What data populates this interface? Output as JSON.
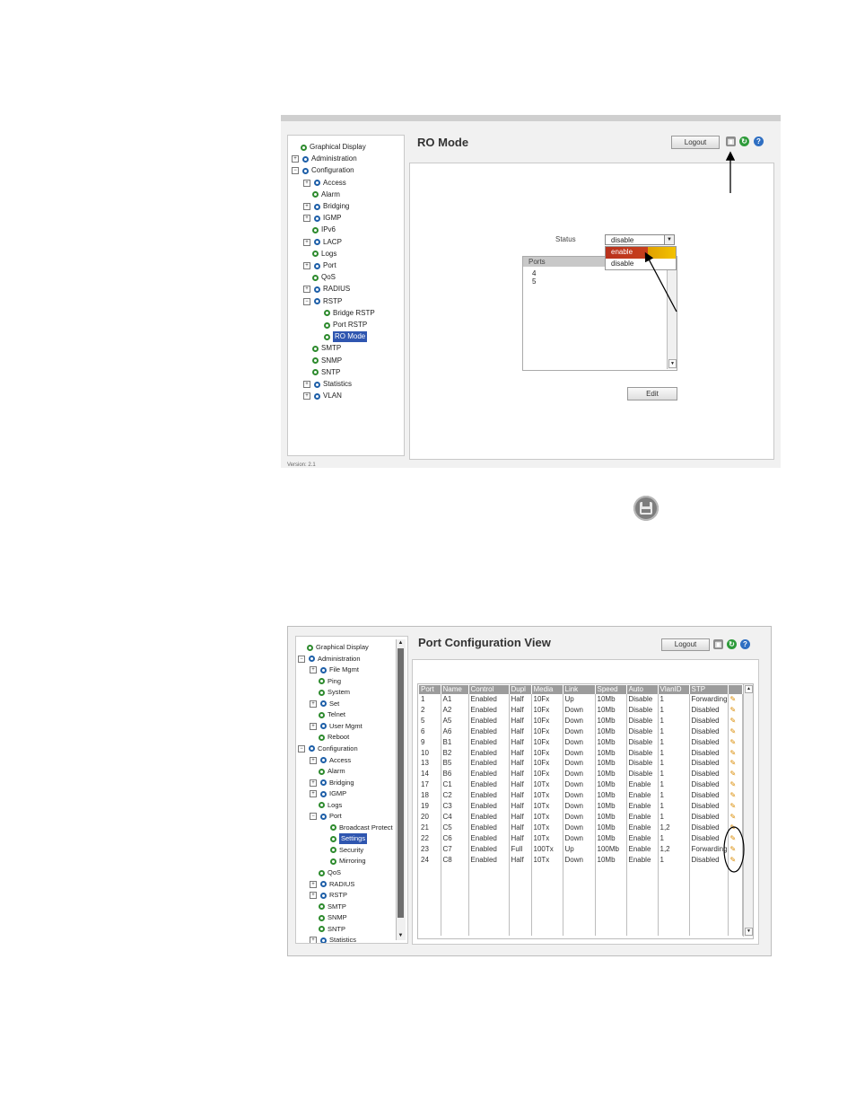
{
  "shot1": {
    "tree": [
      {
        "label": "Graphical Display",
        "level": 0,
        "expander": "",
        "dot": "green"
      },
      {
        "label": "Administration",
        "level": 0,
        "expander": "+",
        "dot": "blue"
      },
      {
        "label": "Configuration",
        "level": 0,
        "expander": "-",
        "dot": "blue"
      },
      {
        "label": "Access",
        "level": 1,
        "expander": "+",
        "dot": "blue"
      },
      {
        "label": "Alarm",
        "level": 1,
        "expander": "",
        "dot": "green"
      },
      {
        "label": "Bridging",
        "level": 1,
        "expander": "+",
        "dot": "blue"
      },
      {
        "label": "IGMP",
        "level": 1,
        "expander": "+",
        "dot": "blue"
      },
      {
        "label": "IPv6",
        "level": 1,
        "expander": "",
        "dot": "green"
      },
      {
        "label": "LACP",
        "level": 1,
        "expander": "+",
        "dot": "blue"
      },
      {
        "label": "Logs",
        "level": 1,
        "expander": "",
        "dot": "green"
      },
      {
        "label": "Port",
        "level": 1,
        "expander": "+",
        "dot": "blue"
      },
      {
        "label": "QoS",
        "level": 1,
        "expander": "",
        "dot": "green"
      },
      {
        "label": "RADIUS",
        "level": 1,
        "expander": "+",
        "dot": "blue"
      },
      {
        "label": "RSTP",
        "level": 1,
        "expander": "-",
        "dot": "blue"
      },
      {
        "label": "Bridge RSTP",
        "level": 2,
        "expander": "",
        "dot": "green"
      },
      {
        "label": "Port RSTP",
        "level": 2,
        "expander": "",
        "dot": "green"
      },
      {
        "label": "RO Mode",
        "level": 2,
        "expander": "",
        "dot": "green",
        "selected": true
      },
      {
        "label": "SMTP",
        "level": 1,
        "expander": "",
        "dot": "green"
      },
      {
        "label": "SNMP",
        "level": 1,
        "expander": "",
        "dot": "green"
      },
      {
        "label": "SNTP",
        "level": 1,
        "expander": "",
        "dot": "green"
      },
      {
        "label": "Statistics",
        "level": 1,
        "expander": "+",
        "dot": "blue"
      },
      {
        "label": "VLAN",
        "level": 1,
        "expander": "+",
        "dot": "blue"
      }
    ],
    "version": "Version: 2.1",
    "title": "RO Mode",
    "logout": "Logout",
    "status_label": "Status",
    "status_value": "disable",
    "status_options": [
      "enable",
      "disable"
    ],
    "ports_header": "Ports",
    "ports": [
      "4",
      "5"
    ],
    "edit": "Edit"
  },
  "shot2": {
    "tree": [
      {
        "label": "Graphical Display",
        "level": 0,
        "expander": "",
        "dot": "green"
      },
      {
        "label": "Administration",
        "level": 0,
        "expander": "-",
        "dot": "blue"
      },
      {
        "label": "File Mgmt",
        "level": 1,
        "expander": "+",
        "dot": "blue"
      },
      {
        "label": "Ping",
        "level": 1,
        "expander": "",
        "dot": "green"
      },
      {
        "label": "System",
        "level": 1,
        "expander": "",
        "dot": "green"
      },
      {
        "label": "Set",
        "level": 1,
        "expander": "+",
        "dot": "blue"
      },
      {
        "label": "Telnet",
        "level": 1,
        "expander": "",
        "dot": "green"
      },
      {
        "label": "User Mgmt",
        "level": 1,
        "expander": "+",
        "dot": "blue"
      },
      {
        "label": "Reboot",
        "level": 1,
        "expander": "",
        "dot": "green"
      },
      {
        "label": "Configuration",
        "level": 0,
        "expander": "-",
        "dot": "blue"
      },
      {
        "label": "Access",
        "level": 1,
        "expander": "+",
        "dot": "blue"
      },
      {
        "label": "Alarm",
        "level": 1,
        "expander": "",
        "dot": "green"
      },
      {
        "label": "Bridging",
        "level": 1,
        "expander": "+",
        "dot": "blue"
      },
      {
        "label": "IGMP",
        "level": 1,
        "expander": "+",
        "dot": "blue"
      },
      {
        "label": "Logs",
        "level": 1,
        "expander": "",
        "dot": "green"
      },
      {
        "label": "Port",
        "level": 1,
        "expander": "-",
        "dot": "blue"
      },
      {
        "label": "Broadcast Protect",
        "level": 2,
        "expander": "",
        "dot": "green"
      },
      {
        "label": "Settings",
        "level": 2,
        "expander": "",
        "dot": "green",
        "selected": true
      },
      {
        "label": "Security",
        "level": 2,
        "expander": "",
        "dot": "green"
      },
      {
        "label": "Mirroring",
        "level": 2,
        "expander": "",
        "dot": "green"
      },
      {
        "label": "QoS",
        "level": 1,
        "expander": "",
        "dot": "green"
      },
      {
        "label": "RADIUS",
        "level": 1,
        "expander": "+",
        "dot": "blue"
      },
      {
        "label": "RSTP",
        "level": 1,
        "expander": "+",
        "dot": "blue"
      },
      {
        "label": "SMTP",
        "level": 1,
        "expander": "",
        "dot": "green"
      },
      {
        "label": "SNMP",
        "level": 1,
        "expander": "",
        "dot": "green"
      },
      {
        "label": "SNTP",
        "level": 1,
        "expander": "",
        "dot": "green"
      },
      {
        "label": "Statistics",
        "level": 1,
        "expander": "+",
        "dot": "blue"
      }
    ],
    "title": "Port Configuration View",
    "logout": "Logout",
    "columns": [
      "Port",
      "Name",
      "Control",
      "Dupl",
      "Media",
      "Link",
      "Speed",
      "Auto",
      "VlanID",
      "STP"
    ],
    "rows": [
      [
        "1",
        "A1",
        "Enabled",
        "Half",
        "10Fx",
        "Up",
        "10Mb",
        "Disable",
        "1",
        "Forwarding"
      ],
      [
        "2",
        "A2",
        "Enabled",
        "Half",
        "10Fx",
        "Down",
        "10Mb",
        "Disable",
        "1",
        "Disabled"
      ],
      [
        "5",
        "A5",
        "Enabled",
        "Half",
        "10Fx",
        "Down",
        "10Mb",
        "Disable",
        "1",
        "Disabled"
      ],
      [
        "6",
        "A6",
        "Enabled",
        "Half",
        "10Fx",
        "Down",
        "10Mb",
        "Disable",
        "1",
        "Disabled"
      ],
      [
        "9",
        "B1",
        "Enabled",
        "Half",
        "10Fx",
        "Down",
        "10Mb",
        "Disable",
        "1",
        "Disabled"
      ],
      [
        "10",
        "B2",
        "Enabled",
        "Half",
        "10Fx",
        "Down",
        "10Mb",
        "Disable",
        "1",
        "Disabled"
      ],
      [
        "13",
        "B5",
        "Enabled",
        "Half",
        "10Fx",
        "Down",
        "10Mb",
        "Disable",
        "1",
        "Disabled"
      ],
      [
        "14",
        "B6",
        "Enabled",
        "Half",
        "10Fx",
        "Down",
        "10Mb",
        "Disable",
        "1",
        "Disabled"
      ],
      [
        "17",
        "C1",
        "Enabled",
        "Half",
        "10Tx",
        "Down",
        "10Mb",
        "Enable",
        "1",
        "Disabled"
      ],
      [
        "18",
        "C2",
        "Enabled",
        "Half",
        "10Tx",
        "Down",
        "10Mb",
        "Enable",
        "1",
        "Disabled"
      ],
      [
        "19",
        "C3",
        "Enabled",
        "Half",
        "10Tx",
        "Down",
        "10Mb",
        "Enable",
        "1",
        "Disabled"
      ],
      [
        "20",
        "C4",
        "Enabled",
        "Half",
        "10Tx",
        "Down",
        "10Mb",
        "Enable",
        "1",
        "Disabled"
      ],
      [
        "21",
        "C5",
        "Enabled",
        "Half",
        "10Tx",
        "Down",
        "10Mb",
        "Enable",
        "1,2",
        "Disabled"
      ],
      [
        "22",
        "C6",
        "Enabled",
        "Half",
        "10Tx",
        "Down",
        "10Mb",
        "Enable",
        "1",
        "Disabled"
      ],
      [
        "23",
        "C7",
        "Enabled",
        "Full",
        "100Tx",
        "Up",
        "100Mb",
        "Enable",
        "1,2",
        "Forwarding"
      ],
      [
        "24",
        "C8",
        "Enabled",
        "Half",
        "10Tx",
        "Down",
        "10Mb",
        "Enable",
        "1",
        "Disabled"
      ]
    ]
  }
}
